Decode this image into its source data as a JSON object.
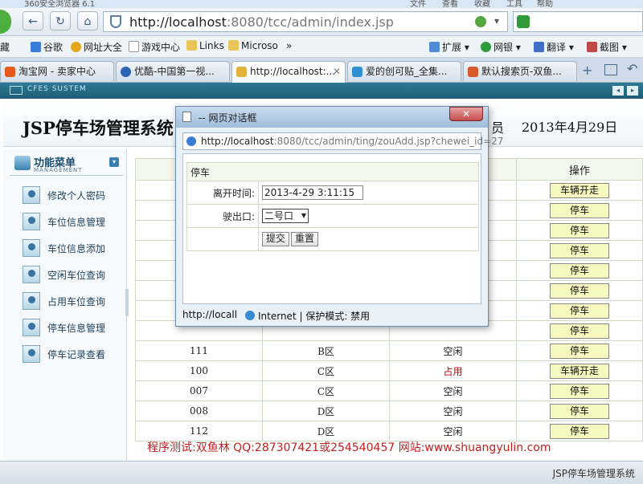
{
  "browser": {
    "title": "360安全浏览器 6.1",
    "title_menus": [
      "文件",
      "查看",
      "收藏",
      "工具",
      "帮助"
    ],
    "address_host": "http://localhost",
    "address_rest": ":8080/tcc/admin/index.jsp",
    "bookmarks": [
      {
        "label": "藏"
      },
      {
        "label": "谷歌"
      },
      {
        "label": "网址大全"
      },
      {
        "label": "游戏中心"
      },
      {
        "label": "Links"
      },
      {
        "label": "Microso"
      },
      {
        "label": "»"
      }
    ],
    "toolbar_right": [
      {
        "label": "扩展"
      },
      {
        "label": "网银"
      },
      {
        "label": "翻译"
      },
      {
        "label": "截图"
      }
    ],
    "tabs": [
      {
        "label": "淘宝网 - 卖家中心"
      },
      {
        "label": "优酷-中国第一视..."
      },
      {
        "label": "http://localhost:..."
      },
      {
        "label": "爱的创可贴_全集..."
      },
      {
        "label": "默认搜索页-双鱼..."
      }
    ],
    "plus": "+"
  },
  "app": {
    "system_tag": "CFES SUSTEM",
    "title": "JSP停车场管理系统",
    "header_text_1": "员",
    "header_text_2": "统",
    "date": "2013年4月29日",
    "menu": {
      "title": "功能菜单",
      "subtitle": "MANAGEMENT",
      "items": [
        {
          "label": "修改个人密码"
        },
        {
          "label": "车位信息管理"
        },
        {
          "label": "车位信息添加"
        },
        {
          "label": "空闲车位查询"
        },
        {
          "label": "占用车位查询"
        },
        {
          "label": "停车信息管理"
        },
        {
          "label": "停车记录查看"
        }
      ]
    },
    "table": {
      "op_header": "操作",
      "rows_top": [
        {
          "op": "车辆开走"
        },
        {
          "op": "停车"
        },
        {
          "op": "停车"
        },
        {
          "op": "停车"
        },
        {
          "op": "停车"
        },
        {
          "op": "停车"
        },
        {
          "op": "停车"
        },
        {
          "op": "停车"
        }
      ],
      "rows": [
        {
          "no": "111",
          "area": "B区",
          "status": "空闲",
          "op": "停车",
          "busy": false
        },
        {
          "no": "100",
          "area": "C区",
          "status": "占用",
          "op": "车辆开走",
          "busy": true
        },
        {
          "no": "007",
          "area": "C区",
          "status": "空闲",
          "op": "停车",
          "busy": false
        },
        {
          "no": "008",
          "area": "D区",
          "status": "空闲",
          "op": "停车",
          "busy": false
        },
        {
          "no": "112",
          "area": "D区",
          "status": "空闲",
          "op": "停车",
          "busy": false
        }
      ]
    },
    "footer": "程序测试:双鱼林 QQ:287307421或254540457 网站:www.shuangyulin.com",
    "statusbar": "JSP停车场管理系统"
  },
  "dialog": {
    "title": "-- 网页对话框",
    "close": "✕",
    "address_host": "http://localhost",
    "address_rest": ":8080/tcc/admin/ting/zouAdd.jsp?chewei_id=27",
    "form_header": "停车",
    "leave_time_label": "离开时间:",
    "leave_time_value": "2013-4-29 3:11:15",
    "exit_label": "驶出口:",
    "exit_value": "二号口",
    "submit_label": "提交",
    "reset_label": "重置",
    "status_url": "http://locall",
    "status_zone": "Internet | 保护模式: 禁用"
  }
}
